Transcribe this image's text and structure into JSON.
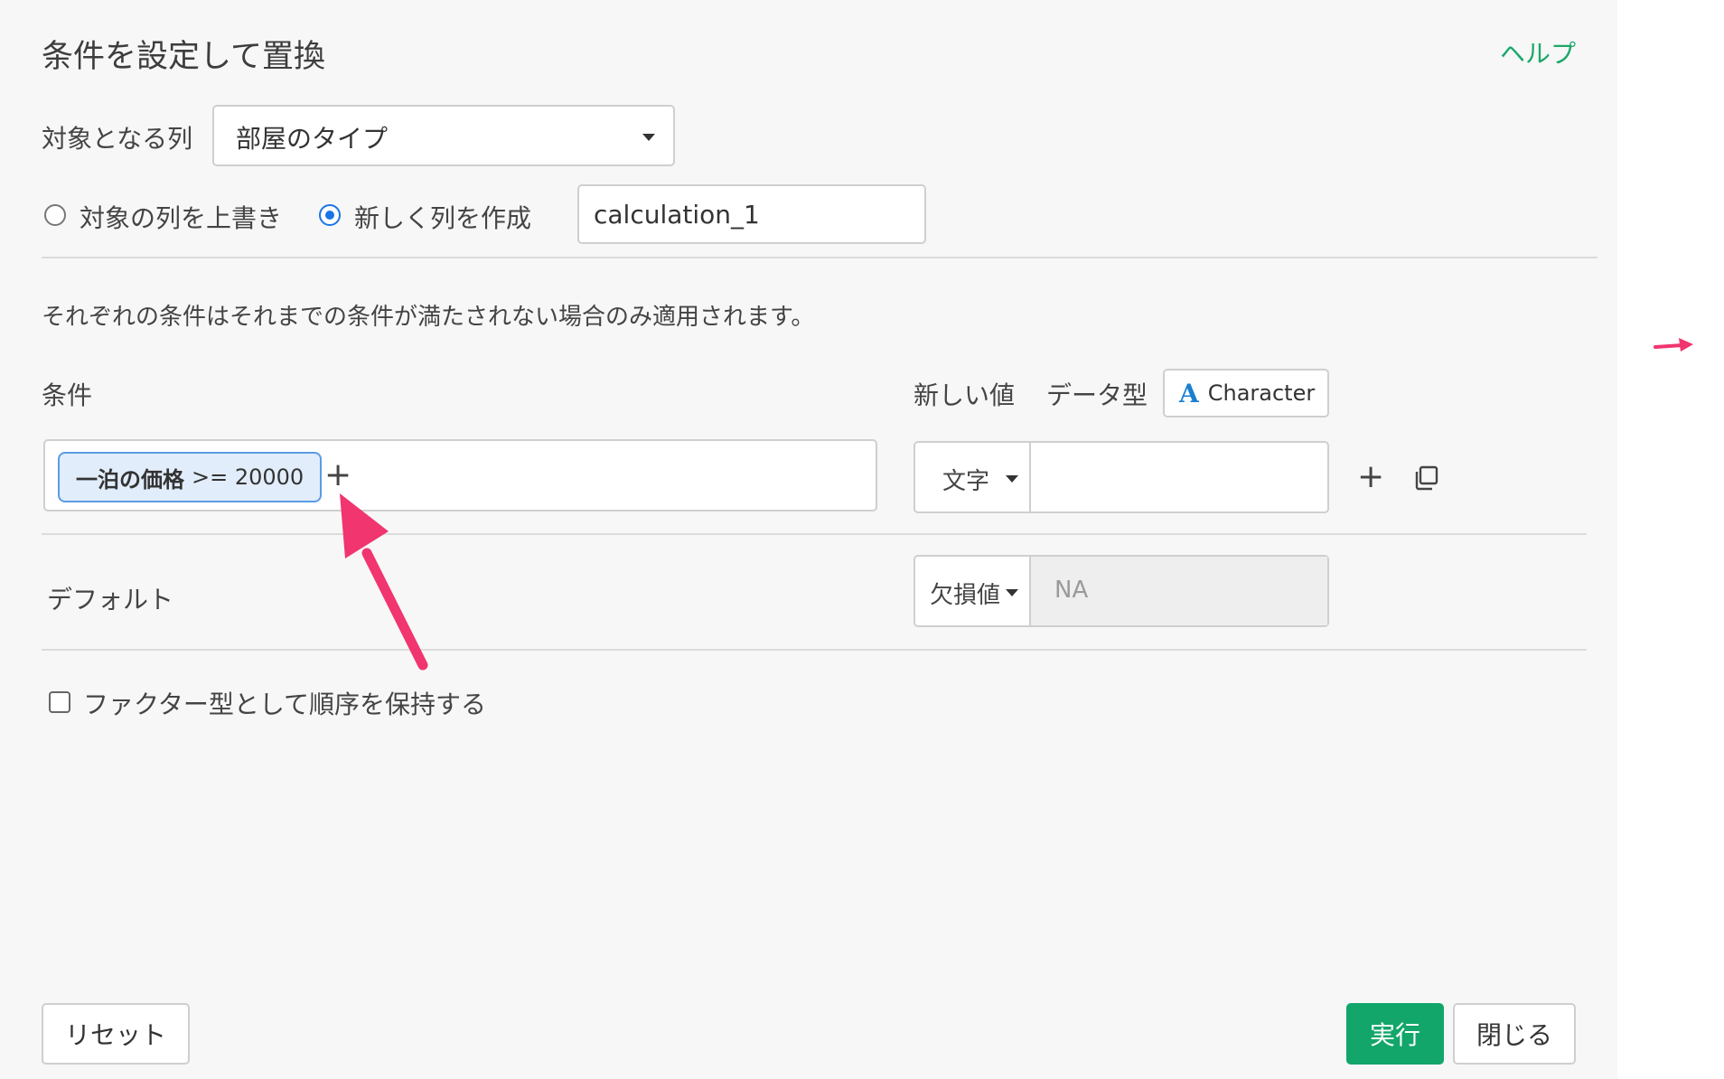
{
  "dialog": {
    "title": "条件を設定して置換",
    "help_label": "ヘルプ"
  },
  "target": {
    "label": "対象となる列",
    "selected_column": "部屋のタイプ"
  },
  "output": {
    "overwrite_label": "対象の列を上書き",
    "new_column_label": "新しく列を作成",
    "selected_option": "new_column",
    "new_column_name": "calculation_1"
  },
  "note": "それぞれの条件はそれまでの条件が満たされない場合のみ適用されます。",
  "conditions": {
    "header_label": "条件",
    "new_value_label": "新しい値",
    "data_type_label": "データ型",
    "data_type_icon": "A",
    "data_type_value": "Character",
    "rows": [
      {
        "column": "一泊の価格",
        "operator_value": ">= 20000",
        "value_type": "文字",
        "new_value": ""
      }
    ]
  },
  "default": {
    "label": "デフォルト",
    "type": "欠損値",
    "value": "NA"
  },
  "factor_option": {
    "label": "ファクター型として順序を保持する",
    "checked": false
  },
  "footer": {
    "reset_label": "リセット",
    "run_label": "実行",
    "close_label": "閉じる"
  },
  "colors": {
    "accent_green": "#12a66a",
    "annotation_arrow": "#f0356f",
    "chip_border": "#5b9be6"
  }
}
